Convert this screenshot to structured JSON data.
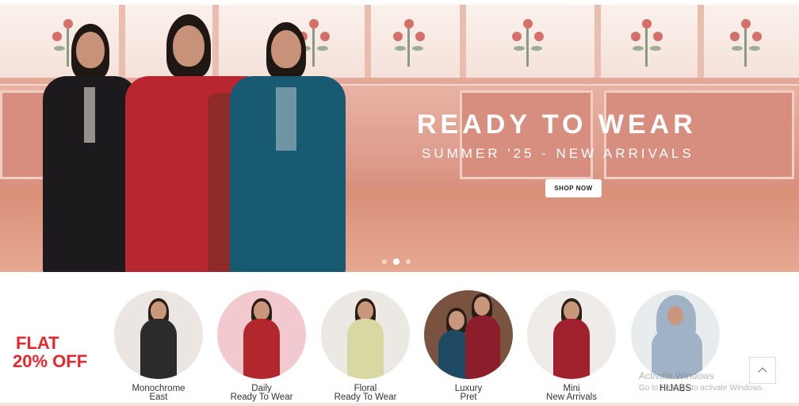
{
  "hero": {
    "title": "READY TO WEAR",
    "subtitle": "SUMMER '25 - NEW ARRIVALS",
    "cta_label": "SHOP NOW",
    "slide_count": 3,
    "active_slide": 2
  },
  "promo": {
    "line1": "FLAT",
    "line2": "20% OFF"
  },
  "categories": [
    {
      "line1": "Monochrome",
      "line2": "East"
    },
    {
      "line1": "Daily",
      "line2": "Ready To Wear"
    },
    {
      "line1": "Floral",
      "line2": "Ready To Wear"
    },
    {
      "line1": "Luxury",
      "line2": "Pret"
    },
    {
      "line1": "Mini",
      "line2": "New Arrivals"
    },
    {
      "line1": "HIJABS",
      "line2": ""
    }
  ],
  "watermark": {
    "line1": "Activate Windows",
    "line2": "Go to Settings to activate Windows."
  },
  "colors": {
    "promo_red": "#e8262b",
    "hero_pink": "#d88e7e",
    "white": "#ffffff"
  },
  "icons": {
    "scroll_top": "chevron-up-icon"
  }
}
